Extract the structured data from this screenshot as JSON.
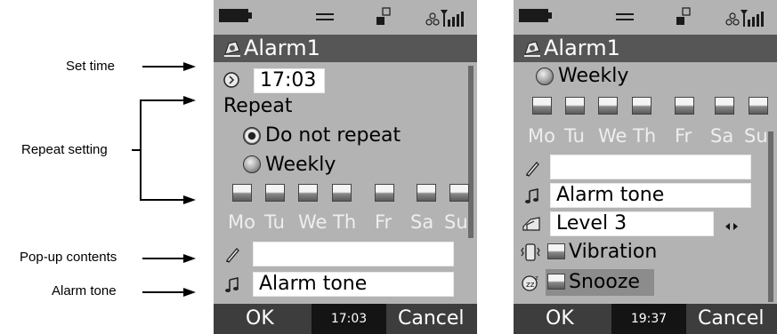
{
  "annotations": {
    "set_time": "Set time",
    "repeat_setting": "Repeat setting",
    "popup_contents": "Pop-up contents",
    "alarm_tone": "Alarm tone"
  },
  "screen1": {
    "title": "Alarm1",
    "time_value": "17:03",
    "repeat_label": "Repeat",
    "opt_no_repeat": "Do not repeat",
    "opt_weekly": "Weekly",
    "days": [
      "Mo",
      "Tu",
      "We",
      "Th",
      "Fr",
      "Sa",
      "Su"
    ],
    "popup_value": "",
    "tone_value": "Alarm tone",
    "softkey_left": "OK",
    "clock": "17:03",
    "softkey_right": "Cancel"
  },
  "screen2": {
    "title": "Alarm1",
    "opt_weekly": "Weekly",
    "days": [
      "Mo",
      "Tu",
      "We",
      "Th",
      "Fr",
      "Sa",
      "Su"
    ],
    "popup_value": "",
    "tone_value": "Alarm tone",
    "volume_value": "Level 3",
    "vibration_label": "Vibration",
    "snooze_label": "Snooze",
    "softkey_left": "OK",
    "clock": "19:37",
    "softkey_right": "Cancel"
  },
  "icons": {
    "battery": "battery-icon",
    "menu": "menu-icon",
    "network": "network-icon",
    "signal": "signal-icon",
    "alarm": "alarm-bell-icon",
    "clock": "clock-icon",
    "pencil": "pencil-icon",
    "music": "music-note-icon",
    "volume": "volume-icon",
    "vibration": "vibration-icon",
    "snooze": "snooze-icon",
    "arrows": "left-right-arrows-icon"
  }
}
